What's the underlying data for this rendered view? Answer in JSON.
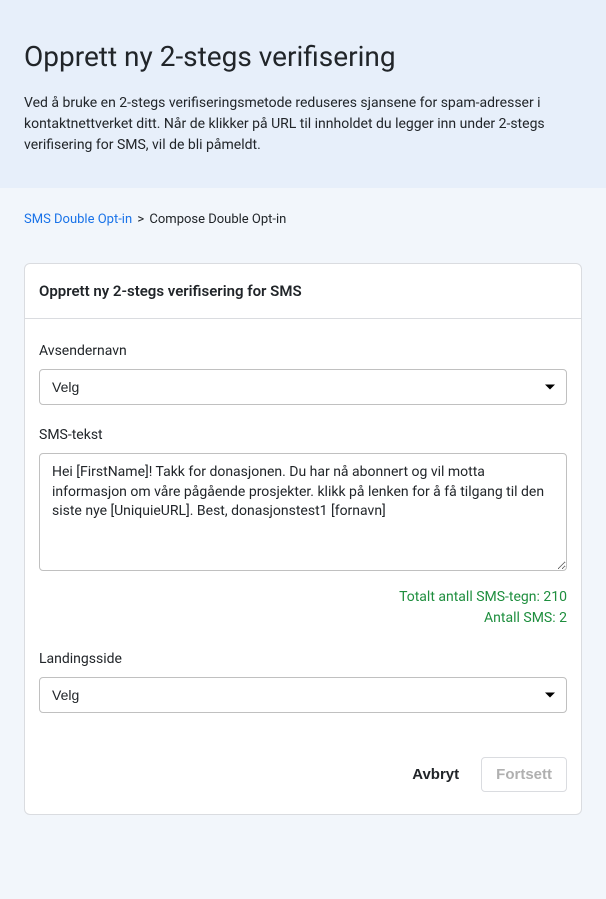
{
  "header": {
    "title": "Opprett ny 2-stegs verifisering",
    "description": "Ved å bruke en 2-stegs verifiseringsmetode reduseres sjansene for spam-adresser i kontaktnettverket ditt. Når de klikker på URL til innholdet du legger inn under 2-stegs verifisering for SMS, vil de bli påmeldt."
  },
  "breadcrumb": {
    "link_label": "SMS Double Opt-in",
    "separator": ">",
    "current": "Compose Double Opt-in"
  },
  "card": {
    "title": "Opprett ny 2-stegs verifisering for SMS"
  },
  "form": {
    "sender_name": {
      "label": "Avsendernavn",
      "value": "Velg"
    },
    "sms_text": {
      "label": "SMS-tekst",
      "value": "Hei [FirstName]! Takk for donasjonen. Du har nå abonnert og vil motta informasjon om våre pågående prosjekter. klikk på lenken for å få tilgang til den siste nye [UniquieURL]. Best, donasjonstest1 [fornavn]"
    },
    "stats": {
      "total_chars_label": "Totalt antall SMS-tegn:",
      "total_chars_value": "210",
      "sms_count_label": "Antall SMS:",
      "sms_count_value": "2"
    },
    "landing_page": {
      "label": "Landingsside",
      "value": "Velg"
    }
  },
  "actions": {
    "cancel": "Avbryt",
    "continue": "Fortsett"
  }
}
